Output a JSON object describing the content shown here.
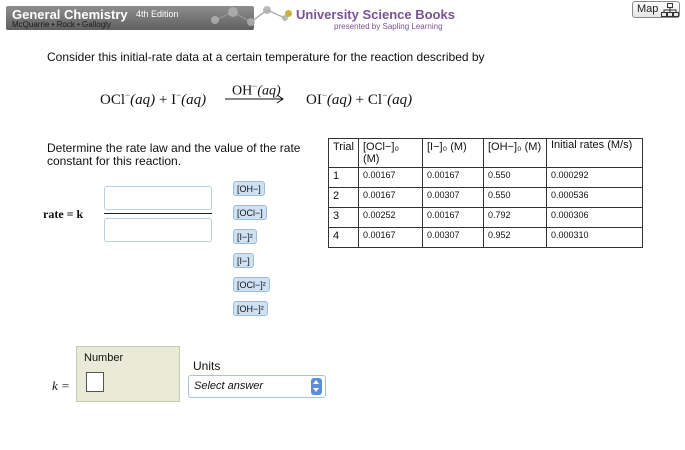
{
  "header": {
    "book_title": "General Chemistry",
    "book_edition": "4th Edition",
    "book_authors": "McQuarrie • Rock • Gallogly",
    "publisher": "University Science Books",
    "publisher_sub": "presented by Sapling Learning",
    "map_label": "Map",
    "map_icon": "sitemap-icon"
  },
  "question": {
    "prompt": "Consider this initial-rate data at a certain temperature for the reaction described by",
    "reaction": {
      "reactant1": "OCl",
      "reactant1_charge": "−",
      "reactant1_state": "(aq)",
      "plus1": " + ",
      "reactant2": "I",
      "reactant2_charge": "−",
      "reactant2_state": "(aq)",
      "catalyst": "OH",
      "catalyst_charge": "−",
      "catalyst_state": "(aq)",
      "product1": "OI",
      "product1_charge": "−",
      "product1_state": "(aq)",
      "plus2": " + ",
      "product2": "Cl",
      "product2_charge": "−",
      "product2_state": "(aq)"
    },
    "instruction": "Determine the rate law and the value of the rate constant for this reaction."
  },
  "table": {
    "headers": [
      "Trial",
      "[OCl−]₀ (M)",
      "[I−]₀ (M)",
      "[OH−]₀ (M)",
      "Initial rates (M/s)"
    ],
    "rows": [
      [
        "1",
        "0.00167",
        "0.00167",
        "0.550",
        "0.000292"
      ],
      [
        "2",
        "0.00167",
        "0.00307",
        "0.550",
        "0.000536"
      ],
      [
        "3",
        "0.00252",
        "0.00167",
        "0.792",
        "0.000306"
      ],
      [
        "4",
        "0.00167",
        "0.00307",
        "0.952",
        "0.000310"
      ]
    ]
  },
  "rate_law": {
    "label": "rate = k",
    "chips": [
      "[OH−]",
      "[OCl−]",
      "[I−]²",
      "[I−]",
      "[OCl−]²",
      "[OH−]²"
    ]
  },
  "answer": {
    "k_label": "k =",
    "number_title": "Number",
    "number_value": "",
    "units_label": "Units",
    "units_placeholder": "Select answer"
  },
  "colors": {
    "header_gray": "#6f6f6f",
    "publisher_purple": "#7a5296",
    "chip_blue": "#cfe2f5",
    "spinner_blue": "#5b8ed6",
    "number_panel": "#e9ebd8"
  }
}
